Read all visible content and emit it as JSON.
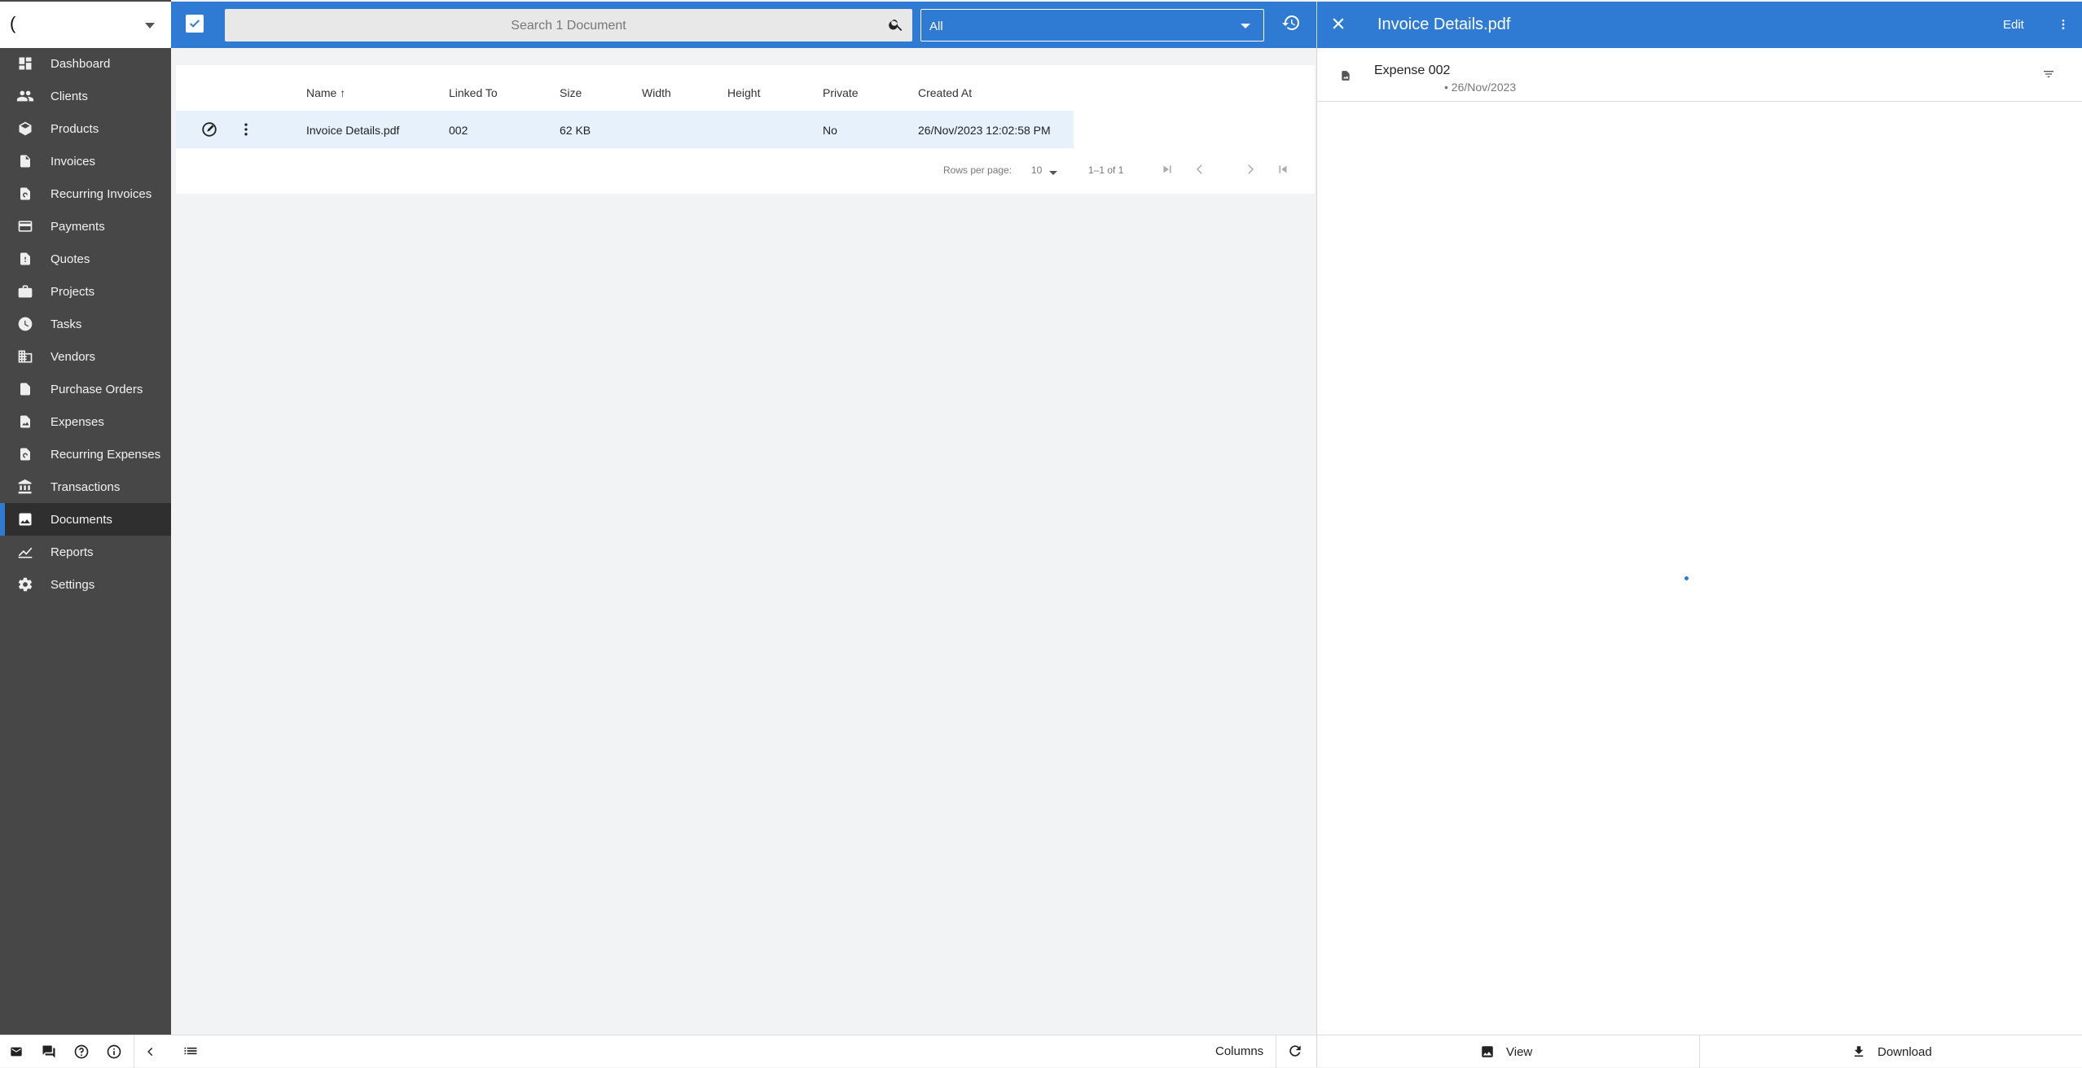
{
  "company": {
    "name": "("
  },
  "sidebar": {
    "items": [
      {
        "label": "Dashboard",
        "icon": "dashboard-icon"
      },
      {
        "label": "Clients",
        "icon": "people-icon"
      },
      {
        "label": "Products",
        "icon": "cube-icon"
      },
      {
        "label": "Invoices",
        "icon": "invoice-icon"
      },
      {
        "label": "Recurring Invoices",
        "icon": "recurring-invoice-icon"
      },
      {
        "label": "Payments",
        "icon": "credit-card-icon"
      },
      {
        "label": "Quotes",
        "icon": "quote-icon"
      },
      {
        "label": "Projects",
        "icon": "briefcase-icon"
      },
      {
        "label": "Tasks",
        "icon": "clock-icon"
      },
      {
        "label": "Vendors",
        "icon": "building-icon"
      },
      {
        "label": "Purchase Orders",
        "icon": "purchase-order-icon"
      },
      {
        "label": "Expenses",
        "icon": "expense-icon"
      },
      {
        "label": "Recurring Expenses",
        "icon": "recurring-expense-icon"
      },
      {
        "label": "Transactions",
        "icon": "bank-icon"
      },
      {
        "label": "Documents",
        "icon": "image-icon",
        "active": true
      },
      {
        "label": "Reports",
        "icon": "chart-line-icon"
      },
      {
        "label": "Settings",
        "icon": "gear-icon"
      }
    ]
  },
  "toolbar": {
    "search_placeholder": "Search 1 Document",
    "filter_value": "All"
  },
  "table": {
    "columns": [
      "Name",
      "Linked To",
      "Size",
      "Width",
      "Height",
      "Private",
      "Created At"
    ],
    "sort_indicator": "↑",
    "rows": [
      {
        "name": "Invoice Details.pdf",
        "linked_to": "002",
        "size": "62 KB",
        "width": "",
        "height": "",
        "private": "No",
        "created_at": "26/Nov/2023 12:02:58 PM"
      }
    ],
    "pagination": {
      "rows_per_page_label": "Rows per page:",
      "rows_per_page": "10",
      "range": "1–1 of 1"
    }
  },
  "list_bottom": {
    "columns_label": "Columns"
  },
  "panel": {
    "title": "Invoice Details.pdf",
    "edit_label": "Edit",
    "linked": {
      "title": "Expense 002",
      "date": "• 26/Nov/2023"
    },
    "view_label": "View",
    "download_label": "Download"
  },
  "colors": {
    "primary": "#2f7bd3",
    "sidebar": "#474747",
    "sidebar_active": "#2f2f2f"
  }
}
